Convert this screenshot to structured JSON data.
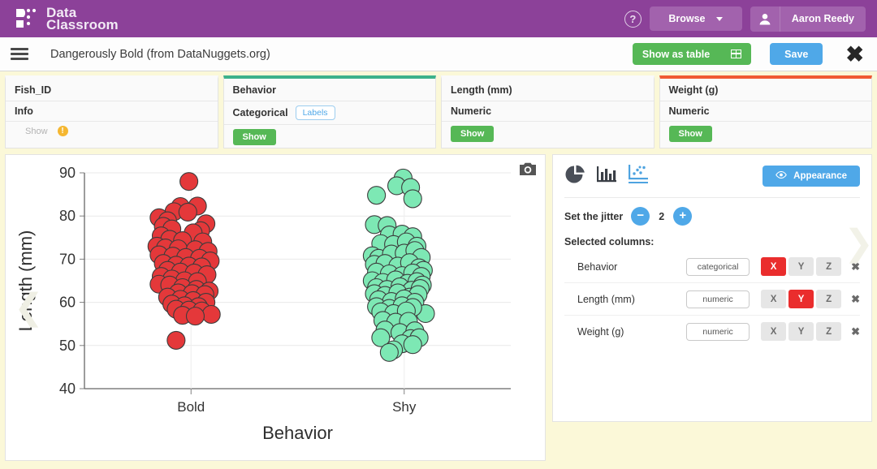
{
  "topbar": {
    "brand_line1": "Data",
    "brand_line2": "Classroom",
    "help_glyph": "?",
    "browse_label": "Browse",
    "user_name": "Aaron Reedy"
  },
  "titlebar": {
    "doc_title": "Dangerously Bold (from DataNuggets.org)",
    "show_as_table_label": "Show as table",
    "save_label": "Save",
    "close_glyph": "✖"
  },
  "columns": [
    {
      "name": "Fish_ID",
      "type": "Info",
      "accent": "#ffffff",
      "show_label": "Show",
      "show_enabled": false,
      "warning_glyph": "!",
      "has_labels_pill": false
    },
    {
      "name": "Behavior",
      "type": "Categorical",
      "accent": "#3cb28a",
      "show_label": "Show",
      "show_enabled": true,
      "has_labels_pill": true,
      "labels_pill": "Labels"
    },
    {
      "name": "Length (mm)",
      "type": "Numeric",
      "accent": "#ffffff",
      "show_label": "Show",
      "show_enabled": true,
      "has_labels_pill": false
    },
    {
      "name": "Weight (g)",
      "type": "Numeric",
      "accent": "#f05a33",
      "show_label": "Show",
      "show_enabled": true,
      "has_labels_pill": false
    }
  ],
  "sidebar": {
    "icons": [
      "pie-chart-icon",
      "bar-chart-icon",
      "scatter-plot-icon"
    ],
    "active_icon": "scatter-plot-icon",
    "appearance_label": "Appearance",
    "jitter_label": "Set the jitter",
    "jitter_value": "2",
    "minus_glyph": "−",
    "plus_glyph": "+",
    "selected_columns_label": "Selected columns:",
    "axis_labels": [
      "X",
      "Y",
      "Z"
    ],
    "remove_glyph": "✖",
    "rows": [
      {
        "name": "Behavior",
        "type": "categorical",
        "axis": "X"
      },
      {
        "name": "Length (mm)",
        "type": "numeric",
        "axis": "Y"
      },
      {
        "name": "Weight (g)",
        "type": "numeric",
        "axis": ""
      }
    ]
  },
  "chart_data": {
    "type": "scatter",
    "title": "",
    "xlabel": "Behavior",
    "ylabel": "Length (mm)",
    "categories": [
      "Bold",
      "Shy"
    ],
    "yticks": [
      40,
      50,
      60,
      70,
      80,
      90
    ],
    "ylim": [
      40,
      90
    ],
    "grid": true,
    "legend": "none",
    "colors": {
      "Bold": "#e4383a",
      "Shy": "#7de8b4",
      "point_stroke": "#3c3c3c"
    },
    "point_radius_px": 11,
    "series": [
      {
        "name": "Bold",
        "color": "#e4383a",
        "points": [
          [
            -0.02,
            88.0
          ],
          [
            -0.1,
            82.2
          ],
          [
            0.06,
            82.3
          ],
          [
            -0.16,
            81.0
          ],
          [
            -0.03,
            80.9
          ],
          [
            -0.3,
            79.6
          ],
          [
            -0.22,
            78.9
          ],
          [
            0.14,
            78.2
          ],
          [
            -0.26,
            77.6
          ],
          [
            -0.18,
            77.0
          ],
          [
            0.09,
            76.6
          ],
          [
            0.02,
            76.1
          ],
          [
            -0.28,
            75.4
          ],
          [
            -0.2,
            74.6
          ],
          [
            -0.08,
            74.3
          ],
          [
            0.11,
            74.0
          ],
          [
            -0.32,
            73.0
          ],
          [
            -0.24,
            72.6
          ],
          [
            -0.12,
            72.4
          ],
          [
            0.04,
            72.2
          ],
          [
            0.16,
            71.8
          ],
          [
            -0.3,
            71.0
          ],
          [
            -0.17,
            70.7
          ],
          [
            -0.05,
            70.4
          ],
          [
            0.08,
            70.2
          ],
          [
            0.18,
            69.6
          ],
          [
            -0.26,
            69.0
          ],
          [
            -0.14,
            68.6
          ],
          [
            -0.02,
            68.4
          ],
          [
            0.1,
            68.2
          ],
          [
            -0.22,
            67.4
          ],
          [
            -0.1,
            67.0
          ],
          [
            0.03,
            66.8
          ],
          [
            0.15,
            66.4
          ],
          [
            -0.28,
            66.0
          ],
          [
            -0.18,
            65.4
          ],
          [
            -0.06,
            65.0
          ],
          [
            0.06,
            64.8
          ],
          [
            -0.3,
            64.2
          ],
          [
            -0.2,
            64.0
          ],
          [
            -0.08,
            63.4
          ],
          [
            0.05,
            63.0
          ],
          [
            0.17,
            62.6
          ],
          [
            -0.12,
            62.2
          ],
          [
            0.01,
            62.0
          ],
          [
            0.13,
            61.8
          ],
          [
            -0.22,
            61.2
          ],
          [
            -0.1,
            60.7
          ],
          [
            0.02,
            60.4
          ],
          [
            0.14,
            60.0
          ],
          [
            -0.18,
            59.6
          ],
          [
            -0.06,
            59.2
          ],
          [
            0.07,
            59.0
          ],
          [
            -0.14,
            58.4
          ],
          [
            -0.02,
            58.2
          ],
          [
            0.1,
            58.0
          ],
          [
            0.19,
            57.2
          ],
          [
            -0.08,
            57.0
          ],
          [
            0.04,
            56.8
          ],
          [
            -0.14,
            51.2
          ]
        ]
      },
      {
        "name": "Shy",
        "color": "#7de8b4",
        "points": [
          [
            -0.01,
            88.8
          ],
          [
            -0.07,
            87.0
          ],
          [
            0.06,
            86.6
          ],
          [
            -0.26,
            84.8
          ],
          [
            0.08,
            84.0
          ],
          [
            -0.28,
            78.0
          ],
          [
            -0.16,
            77.8
          ],
          [
            -0.14,
            75.6
          ],
          [
            -0.02,
            75.8
          ],
          [
            0.08,
            75.2
          ],
          [
            -0.22,
            73.6
          ],
          [
            -0.1,
            73.4
          ],
          [
            0.02,
            74.0
          ],
          [
            0.12,
            73.0
          ],
          [
            -0.3,
            70.8
          ],
          [
            -0.24,
            70.2
          ],
          [
            -0.12,
            71.2
          ],
          [
            0.0,
            71.4
          ],
          [
            0.1,
            72.0
          ],
          [
            0.16,
            70.4
          ],
          [
            -0.28,
            68.8
          ],
          [
            -0.18,
            69.0
          ],
          [
            -0.06,
            68.4
          ],
          [
            0.05,
            69.2
          ],
          [
            0.14,
            68.0
          ],
          [
            0.18,
            67.4
          ],
          [
            -0.26,
            67.0
          ],
          [
            -0.14,
            66.6
          ],
          [
            -0.02,
            66.2
          ],
          [
            0.08,
            66.8
          ],
          [
            0.16,
            66.0
          ],
          [
            -0.3,
            65.0
          ],
          [
            -0.2,
            64.6
          ],
          [
            -0.08,
            65.2
          ],
          [
            0.03,
            64.4
          ],
          [
            0.12,
            64.8
          ],
          [
            0.17,
            64.0
          ],
          [
            -0.26,
            63.4
          ],
          [
            -0.16,
            63.0
          ],
          [
            -0.04,
            63.6
          ],
          [
            0.07,
            62.8
          ],
          [
            0.15,
            63.2
          ],
          [
            -0.28,
            62.0
          ],
          [
            -0.18,
            61.6
          ],
          [
            -0.06,
            62.2
          ],
          [
            0.05,
            61.2
          ],
          [
            0.13,
            61.8
          ],
          [
            -0.24,
            60.6
          ],
          [
            -0.12,
            60.2
          ],
          [
            0.0,
            60.8
          ],
          [
            0.1,
            60.0
          ],
          [
            0.2,
            57.4
          ],
          [
            -0.26,
            59.0
          ],
          [
            -0.14,
            58.6
          ],
          [
            -0.02,
            59.2
          ],
          [
            0.08,
            58.8
          ],
          [
            -0.22,
            57.8
          ],
          [
            -0.1,
            57.4
          ],
          [
            0.02,
            58.0
          ],
          [
            -0.2,
            55.8
          ],
          [
            -0.08,
            55.4
          ],
          [
            0.04,
            55.6
          ],
          [
            -0.18,
            53.6
          ],
          [
            -0.04,
            53.0
          ],
          [
            0.1,
            53.4
          ],
          [
            -0.22,
            51.8
          ],
          [
            0.06,
            51.6
          ],
          [
            0.14,
            51.8
          ],
          [
            -0.02,
            50.4
          ],
          [
            0.08,
            50.2
          ],
          [
            -0.1,
            49.0
          ],
          [
            -0.14,
            48.4
          ]
        ]
      }
    ]
  }
}
